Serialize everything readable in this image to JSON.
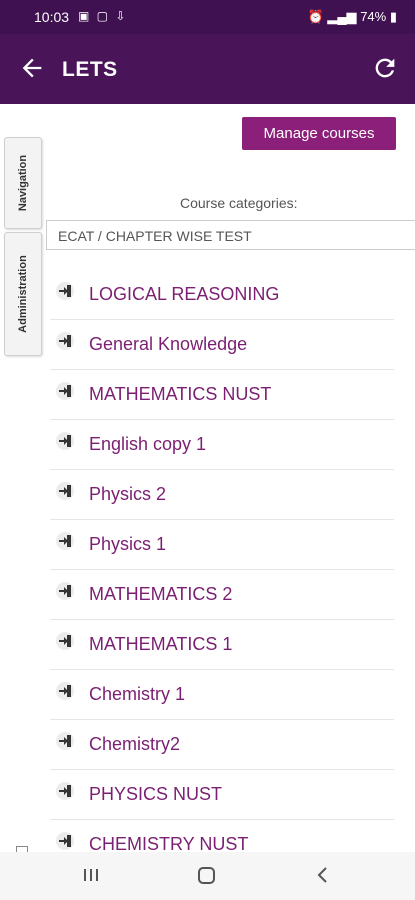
{
  "status_bar": {
    "time": "10:03",
    "battery": "74%"
  },
  "header": {
    "title": "LETS"
  },
  "manage_courses_label": "Manage courses",
  "side_tabs": [
    "Navigation",
    "Administration"
  ],
  "category_label": "Course categories:",
  "category_select_value": "ECAT / CHAPTER WISE TEST",
  "courses": [
    "LOGICAL REASONING",
    "General Knowledge",
    "MATHEMATICS NUST",
    "English copy 1",
    "Physics 2",
    "Physics 1",
    "MATHEMATICS 2",
    "MATHEMATICS 1",
    "Chemistry 1",
    "Chemistry2",
    "PHYSICS NUST",
    "CHEMISTRY NUST"
  ],
  "colors": {
    "header": "#4a1459",
    "button": "#8b1f7a",
    "link": "#7b1f72"
  }
}
